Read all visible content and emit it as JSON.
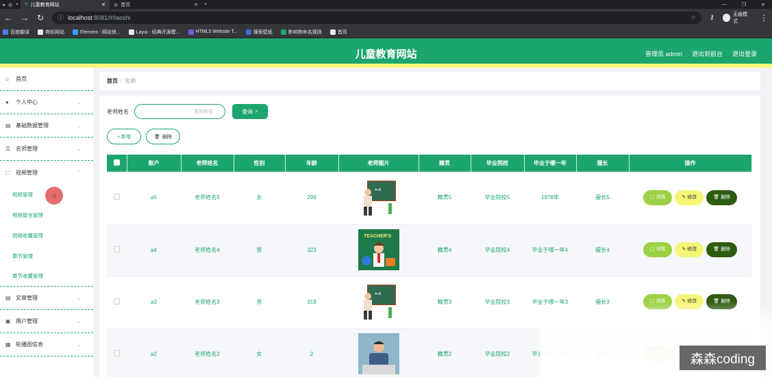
{
  "browser": {
    "tabs": [
      {
        "title": "儿童教育网站",
        "active": true
      },
      {
        "title": "首页",
        "active": false
      }
    ],
    "url_host": "localhost",
    "url_path": ":8081/#/laoshi",
    "incognito_label": "无痕模式",
    "bookmarks": [
      {
        "label": "百度翻译",
        "color": "#4a7ee6"
      },
      {
        "label": "商标网站",
        "color": "#e8eaed"
      },
      {
        "label": "Element - 网站快...",
        "color": "#409eff"
      },
      {
        "label": "Layui - 经典开源模...",
        "color": "#e8eaed"
      },
      {
        "label": "HTML5 Website T...",
        "color": "#6c5ce7"
      },
      {
        "label": "搜索壁纸",
        "color": "#3b6fd6"
      },
      {
        "label": "影响狗命名规则",
        "color": "#1ca56f"
      },
      {
        "label": "首页",
        "color": "#e8eaed"
      }
    ]
  },
  "header": {
    "title": "儿童教育网站",
    "admin": "管理员 admin",
    "back_to_front": "退出到前台",
    "logout": "退出登录"
  },
  "sidebar": {
    "items": [
      {
        "label": "首页",
        "icon": "home-icon",
        "glyph": "⌂"
      },
      {
        "label": "个人中心",
        "icon": "user-icon",
        "glyph": "●"
      },
      {
        "label": "基础数据管理",
        "icon": "box-icon",
        "glyph": "▤"
      },
      {
        "label": "名师管理",
        "icon": "list-icon",
        "glyph": "☰"
      },
      {
        "label": "视频管理",
        "icon": "video-icon",
        "glyph": "⬚"
      },
      {
        "label": "文章管理",
        "icon": "doc-icon",
        "glyph": "▤"
      },
      {
        "label": "用户管理",
        "icon": "users-icon",
        "glyph": "▣"
      },
      {
        "label": "轮播图信息",
        "icon": "grid-icon",
        "glyph": "▦"
      }
    ],
    "video_sub": [
      "视频管理",
      "视频留言管理",
      "视频收藏管理",
      "章节管理",
      "章节收藏管理"
    ]
  },
  "breadcrumb": {
    "home": "首页",
    "current": "名师"
  },
  "search": {
    "label": "老师姓名",
    "placeholder": "老师姓名",
    "button": "查询"
  },
  "actions": {
    "add": "+ 新增",
    "delete": "删除"
  },
  "table": {
    "headers": [
      "账户",
      "老师姓名",
      "性别",
      "年龄",
      "老师图片",
      "籍贯",
      "毕业院校",
      "毕业于哪一年",
      "擅长",
      "操作"
    ],
    "rows": [
      {
        "account": "a5",
        "name": "老师姓名5",
        "gender": "女",
        "age": "299",
        "origin": "籍贯5",
        "school": "毕业院校5",
        "year": "1978年",
        "skill": "擅长5"
      },
      {
        "account": "a4",
        "name": "老师姓名4",
        "gender": "男",
        "age": "323",
        "origin": "籍贯4",
        "school": "毕业院校4",
        "year": "毕业于哪一年4",
        "skill": "擅长4"
      },
      {
        "account": "a3",
        "name": "老师姓名3",
        "gender": "男",
        "age": "319",
        "origin": "籍贯3",
        "school": "毕业院校3",
        "year": "毕业于哪一年3",
        "skill": "擅长3"
      },
      {
        "account": "a2",
        "name": "老师姓名2",
        "gender": "女",
        "age": "2",
        "origin": "籍贯2",
        "school": "毕业院校2",
        "year": "毕业于哪一年2",
        "skill": "擅长2"
      }
    ],
    "ops": {
      "detail": "详情",
      "edit": "修改",
      "delete": "删除"
    }
  },
  "watermark": "森森coding",
  "colors": {
    "primary": "#1ca56f",
    "accent_stripe": "#f5f779",
    "detail": "#9bd142",
    "edit": "#f7f576",
    "delete": "#2f5b10"
  }
}
